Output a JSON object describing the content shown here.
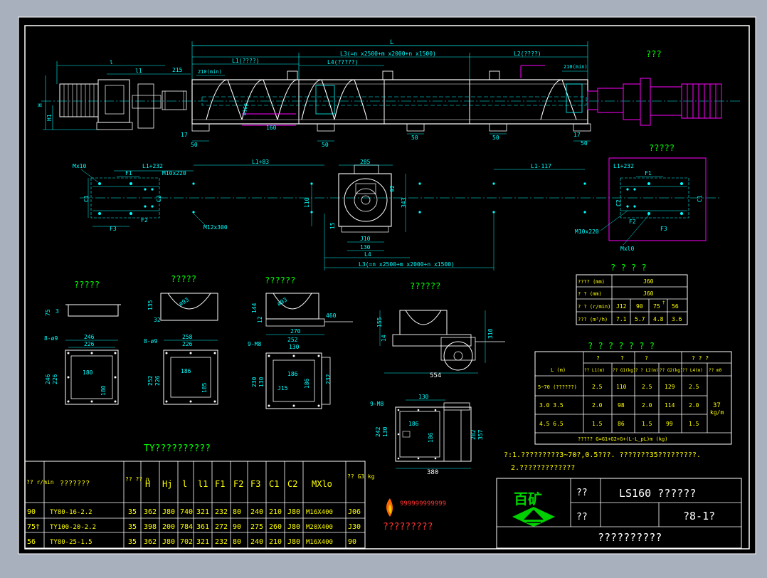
{
  "colors": {
    "background": "#000000",
    "frame": "#ffffff",
    "cyan": "#00ffff",
    "green": "#00ff00",
    "red": "#ff3333",
    "magenta": "#ff00ff",
    "yellow": "#ffff00",
    "white": "#ffffff",
    "logo_green": "#00d000"
  },
  "top_view": {
    "overall_length": "L",
    "l_label": "l",
    "l1_label": "l1",
    "dim_215": "215",
    "dim_210_left": "210(min)",
    "dim_210_right": "210(min)",
    "l1_segment": "L1(????)",
    "l3_segment": "L3(=n x2500+m x2000+n x1500)",
    "l4_segment": "L4(?????)",
    "l2_segment": "L2(????)",
    "h_label": "H",
    "h1_label": "H1",
    "dim_160": "160",
    "dim_17a": "17",
    "dim_17b": "17",
    "dim_50a": "50",
    "dim_50b": "50",
    "dim_50c": "50",
    "dim_50d": "50",
    "dim_50e": "50",
    "dim_phi160": "ø160",
    "right_drive_title": "???"
  },
  "plan_view": {
    "mx10": "Mx10",
    "l1_232_left": "L1+232",
    "m10x220_left": "M10x220",
    "l1_83": "L1+83",
    "dim_285": "285",
    "l1_117": "L1-117",
    "l1_232_right": "L1+232",
    "right_title": "?????",
    "f1_left": "F1",
    "f2_left": "F2",
    "f3_left": "F3",
    "c1_left": "C1",
    "c2_left": "C2",
    "m12x300": "M12x300",
    "dim_110": "110",
    "dim_15": "15",
    "dim_343": "343",
    "dim_92": "92",
    "dim_J10": "J10",
    "dim_130": "130",
    "l4_label": "L4",
    "l3_bottom": "L3(=n x2500+m x2000+n x1500)",
    "f1_right": "F1",
    "f2_right": "F2",
    "f3_right": "F3",
    "c1_right": "C1",
    "c2_right": "C2",
    "m10x220_right": "M10x220",
    "mxl0": "Mxl0"
  },
  "details": {
    "d1_title": "?????",
    "d1_dim_75": "75",
    "d1_dim_3": "3",
    "d1_bolt": "8-ø9",
    "d1_w1": "246",
    "d1_w2": "226",
    "d1_h1": "246",
    "d1_h2": "226",
    "d1_in_w": "180",
    "d1_in_h": "180",
    "d2_title": "?????",
    "d2_dim_135": "135",
    "d2_dim_32": "32",
    "d2_phi": "ø93",
    "d2_bolt": "8-ø9",
    "d2_w1": "258",
    "d2_w2": "226",
    "d2_h1": "252",
    "d2_h2": "226",
    "d2_in_w": "186",
    "d2_in_h": "185",
    "d3_title": "??????",
    "d3_dim_144": "144",
    "d3_dim_12": "12",
    "d3_phi": "ø93",
    "d3_dim_460": "460",
    "d3_dim_270": "270",
    "d3_bolt": "9-M8",
    "d3_w1": "252",
    "d3_w2": "130",
    "d3_h1": "230",
    "d3_h2": "130",
    "d3_in": "186",
    "d3_r": "186",
    "d3_J15": "J15",
    "d3_side": "232",
    "d4_title": "??????",
    "d4_dim_155": "155",
    "d4_dim_14": "14",
    "d4_dim_310": "310",
    "d4_dim_554": "554",
    "d5_bolt": "9-M8",
    "d5_dim_130": "130",
    "d5_dim_242": "242",
    "d5_dim_130b": "130",
    "d5_dim_186a": "186",
    "d5_dim_186b": "186",
    "d5_dim_282": "282",
    "d5_dim_357": "357",
    "d5_dim_380": "380"
  },
  "spec_table": {
    "title": "? ? ? ?",
    "rows": [
      {
        "label": "???? (mm)",
        "values": [
          "J60"
        ]
      },
      {
        "label": "? ? (mm)",
        "values": [
          "J60"
        ]
      },
      {
        "label": "? ? (r/min)",
        "values": [
          "J12",
          "90",
          "75",
          "56"
        ]
      },
      {
        "label": "??? (m³/h)",
        "values": [
          "7.1",
          "5.7",
          "4.8",
          "3.6"
        ]
      }
    ],
    "sup": "†"
  },
  "weight_table": {
    "title": "? ? ? ? ? ? ?",
    "group_headers": [
      "?",
      "?",
      "?",
      "? ? ?"
    ],
    "col_headers": [
      "L (m)",
      "?? L1(m)",
      "?? G1(kg)",
      "? ? L2(m)",
      "?? G2(kg)",
      "?? L4(m)",
      "?? m0"
    ],
    "rows": [
      {
        "l": "5~70 (??????)",
        "values": [
          "2.5",
          "110",
          "2.5",
          "129",
          "2.5"
        ]
      },
      {
        "l": "3.0  3.5",
        "values": [
          "2.0",
          "98",
          "2.0",
          "114",
          "2.0"
        ]
      },
      {
        "l": "4.5  6.5",
        "values": [
          "1.5",
          "86",
          "1.5",
          "99",
          "1.5"
        ]
      }
    ],
    "unit_value": "37",
    "unit_label": "kg/m",
    "formula": "?????  G=G1+G2+G+(L-L_pL)m   (kg)"
  },
  "notes": {
    "line1": "?:1.?????????3~70?,0.5???.  ???????35?????????.",
    "line2": "2.?????????????"
  },
  "motor_table": {
    "title": "TY??????????",
    "headers": [
      "?? r/min",
      "???????",
      "?? ?? n",
      "H",
      "Hj",
      "l",
      "l1",
      "F1",
      "F2",
      "F3",
      "C1",
      "C2",
      "MXlo",
      "?? G3 kg"
    ],
    "rows": [
      [
        "90",
        "TY80-16-2.2",
        "35",
        "362",
        "J80",
        "740",
        "321",
        "232",
        "80",
        "240",
        "210",
        "J80",
        "M16X400",
        "J06"
      ],
      [
        "75†",
        "TY100-20-2.2",
        "35",
        "398",
        "200",
        "784",
        "361",
        "272",
        "90",
        "275",
        "260",
        "J80",
        "M20X400",
        "J30"
      ],
      [
        "56",
        "TY80-25-1.5",
        "35",
        "362",
        "J80",
        "702",
        "321",
        "232",
        "80",
        "240",
        "210",
        "J80",
        "M16X400",
        "90"
      ]
    ]
  },
  "title_block": {
    "logo_text": "百矿",
    "company_mark": "999999999999",
    "company_name": "?????????",
    "label_name": "??",
    "drawing_name": "LS160 ??????",
    "label_no": "??",
    "drawing_no": "?8-1?",
    "bottom_text": "??????????"
  }
}
